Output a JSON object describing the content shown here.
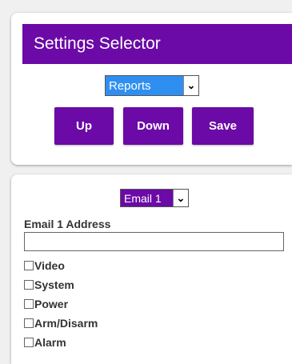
{
  "header": {
    "title": "Settings Selector"
  },
  "report_select": {
    "value": "Reports"
  },
  "buttons": {
    "up": "Up",
    "down": "Down",
    "save": "Save"
  },
  "email_select": {
    "value": "Email 1"
  },
  "email_address": {
    "label": "Email 1 Address",
    "value": ""
  },
  "checkboxes": [
    {
      "label": "Video",
      "checked": false
    },
    {
      "label": "System",
      "checked": false
    },
    {
      "label": "Power",
      "checked": false
    },
    {
      "label": "Arm/Disarm",
      "checked": false
    },
    {
      "label": "Alarm",
      "checked": false
    }
  ],
  "colors": {
    "brand": "#6b0aa6",
    "select_blue": "#2f8ff0"
  }
}
